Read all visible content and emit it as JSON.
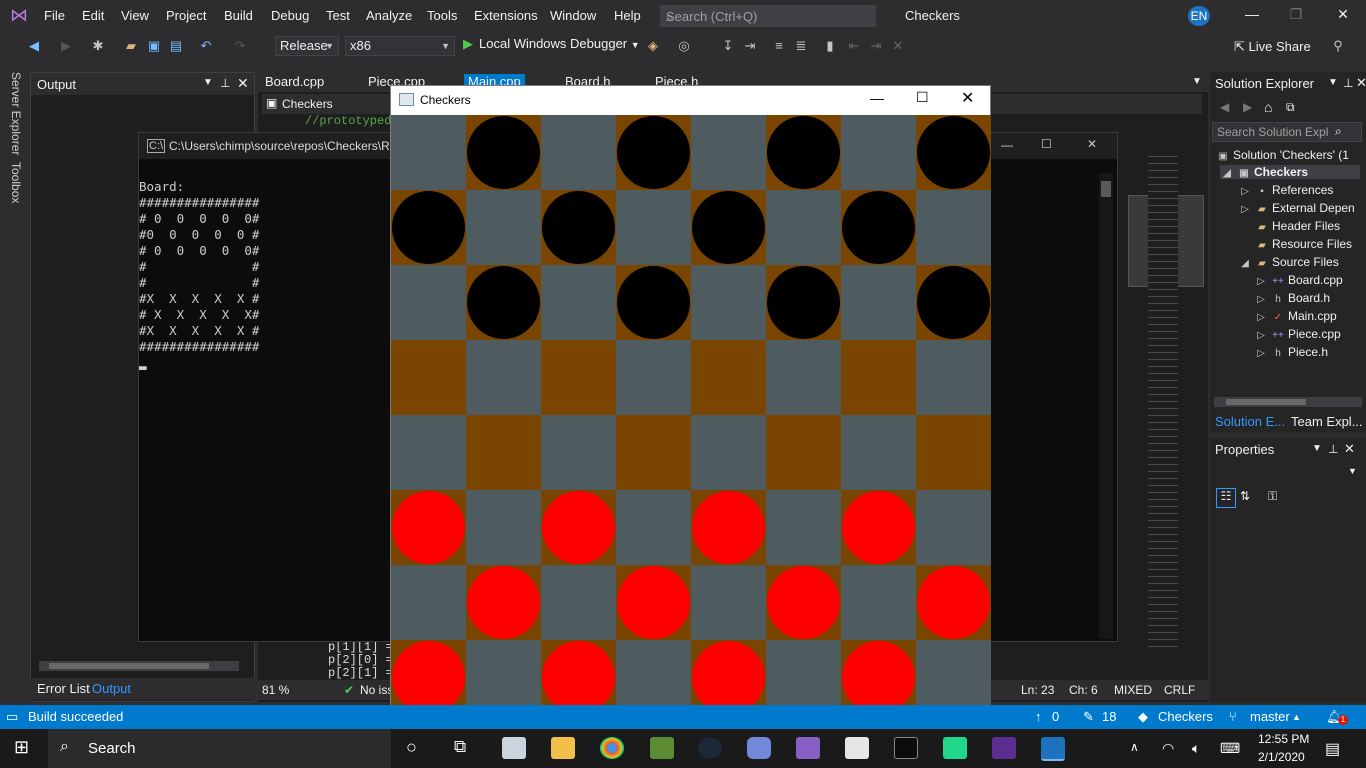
{
  "menubar": {
    "items": [
      "File",
      "Edit",
      "View",
      "Project",
      "Build",
      "Debug",
      "Test",
      "Analyze",
      "Tools",
      "Extensions",
      "Window",
      "Help"
    ],
    "search_placeholder": "Search (Ctrl+Q)",
    "app_title": "Checkers",
    "user_initials": "EN"
  },
  "toolbar": {
    "config": "Release",
    "platform": "x86",
    "run_label": "Local Windows Debugger",
    "liveshare_label": "Live Share"
  },
  "left_strip": {
    "server_explorer": "Server Explorer",
    "toolbox": "Toolbox"
  },
  "output": {
    "title": "Output",
    "tab_error_list": "Error List",
    "tab_output": "Output"
  },
  "editor": {
    "tabs": [
      "Board.cpp",
      "Piece.cpp",
      "Main.cpp",
      "Board.h",
      "Piece.h"
    ],
    "nav_scope": "Checkers",
    "code": [
      "//prototyped fu",
      "p[1][1] = b",
      "p[2][0] = b",
      "p[2][1] = b"
    ],
    "zoom": "81 %",
    "issues": "No iss",
    "ln": "Ln: 23",
    "ch": "Ch: 6",
    "mixed": "MIXED",
    "crlf": "CRLF"
  },
  "solution_explorer": {
    "title": "Solution Explorer",
    "search_placeholder": "Search Solution Expl",
    "solution_label": "Solution 'Checkers' (1",
    "project_label": "Checkers",
    "items": [
      "References",
      "External Depen",
      "Header Files",
      "Resource Files",
      "Source Files",
      "Board.cpp",
      "Board.h",
      "Main.cpp",
      "Piece.cpp",
      "Piece.h"
    ],
    "tab_solution": "Solution E...",
    "tab_team": "Team Expl..."
  },
  "properties": {
    "title": "Properties"
  },
  "console": {
    "title": "C:\\Users\\chimp\\source\\repos\\Checkers\\R",
    "lines": [
      "Board:",
      "################",
      "# 0  0  0  0  0#",
      "#0  0  0  0  0 #",
      "# 0  0  0  0  0#",
      "#              #",
      "#              #",
      "#X  X  X  X  X #",
      "# X  X  X  X  X#",
      "#X  X  X  X  X #",
      "################"
    ]
  },
  "checkers": {
    "title": "Checkers",
    "light_color": "#4e5b5f",
    "dark_color": "#7a4500",
    "black_piece": "#000000",
    "red_piece": "#ff0000",
    "rows": [
      "-b-b-b-b",
      "b-b-b-b-",
      "-b-b-b-b",
      "--------",
      "--------",
      "r-r-r-r-",
      "-r-r-r-r",
      "r-r-r-r-"
    ]
  },
  "statusbar": {
    "message": "Build succeeded",
    "up_count": "0",
    "edit_count": "18",
    "repo": "Checkers",
    "branch": "master",
    "notif": "1"
  },
  "taskbar": {
    "search_label": "Search",
    "time": "12:55 PM",
    "date": "2/1/2020"
  }
}
